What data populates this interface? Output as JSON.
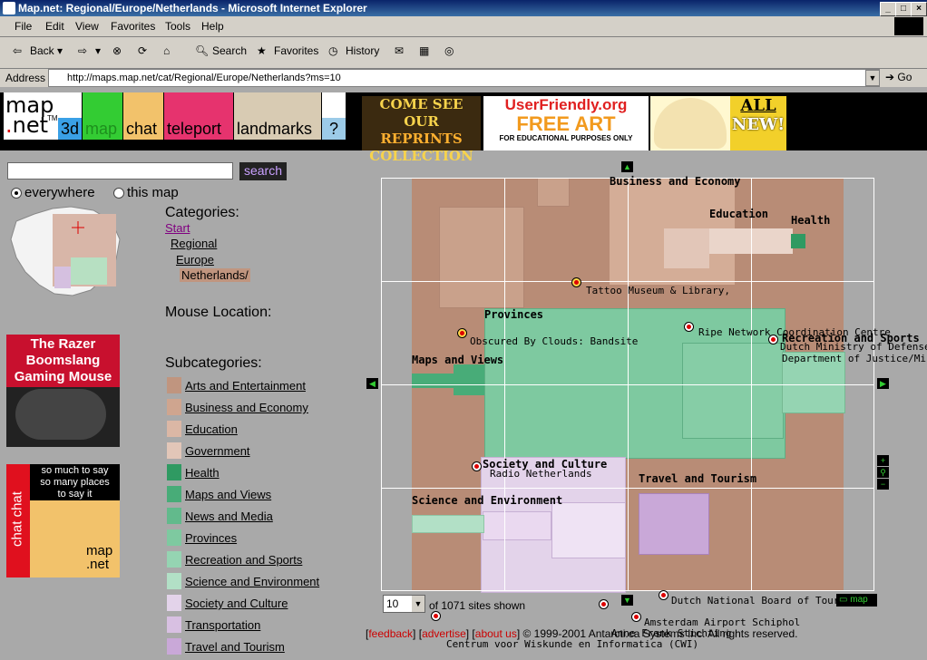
{
  "window": {
    "title": "Map.net: Regional/Europe/Netherlands - Microsoft Internet Explorer"
  },
  "menu": [
    "File",
    "Edit",
    "View",
    "Favorites",
    "Tools",
    "Help"
  ],
  "toolbar": {
    "back": "Back",
    "search": "Search",
    "favorites": "Favorites",
    "history": "History"
  },
  "address": {
    "label": "Address",
    "url": "http://maps.map.net/cat/Regional/Europe/Netherlands?ms=10",
    "go": "Go"
  },
  "nav": {
    "logo_top": "map",
    "logo_bottom": "net",
    "tm": "TM",
    "threed": "3d",
    "map": "map",
    "chat": "chat",
    "teleport": "teleport",
    "landmarks": "landmarks",
    "help": "?"
  },
  "banner": {
    "reprints_1": "COME SEE OUR",
    "reprints_2": "REPRINTS",
    "reprints_3": "COLLECTION",
    "uf_title": "UserFriendly.org",
    "uf_art": "FREE ART",
    "uf_note": "FOR EDUCATIONAL PURPOSES ONLY",
    "all_new_1": "ALL",
    "all_new_2": "NEW!"
  },
  "search": {
    "value": "",
    "button": "search",
    "everywhere": "everywhere",
    "this_map": "this map"
  },
  "categories": {
    "heading": "Categories:",
    "crumbs": [
      "Start",
      "Regional",
      "Europe",
      "Netherlands/"
    ]
  },
  "mouse_location": "Mouse Location:",
  "subcategories": {
    "heading": "Subcategories:",
    "items": [
      {
        "label": "Arts and Entertainment",
        "color": "#c0957f"
      },
      {
        "label": "Business and Economy",
        "color": "#cfa58f"
      },
      {
        "label": "Education",
        "color": "#dbb7a5"
      },
      {
        "label": "Government",
        "color": "#e2c6b8"
      },
      {
        "label": "Health",
        "color": "#2f9a62"
      },
      {
        "label": "Maps and Views",
        "color": "#48ac78"
      },
      {
        "label": "News and Media",
        "color": "#62ba8c"
      },
      {
        "label": "Provinces",
        "color": "#7ec9a0"
      },
      {
        "label": "Recreation and Sports",
        "color": "#95d4b2"
      },
      {
        "label": "Science and Environment",
        "color": "#b2e0c6"
      },
      {
        "label": "Society and Culture",
        "color": "#e3d3ea"
      },
      {
        "label": "Transportation",
        "color": "#d8c0e2"
      },
      {
        "label": "Travel and Tourism",
        "color": "#c9a8d8"
      }
    ]
  },
  "ads": {
    "razer": "The Razer Boomslang Gaming Mouse",
    "chat_side": "chat chat",
    "chat_1": "so much to say",
    "chat_2": "so many places",
    "chat_3": "to say it",
    "chat_map": "map",
    "chat_net": ".net"
  },
  "map": {
    "categories": {
      "business": "Business and Economy",
      "education": "Education",
      "health": "Health",
      "provinces": "Provinces",
      "maps": "Maps and Views",
      "recreation": "Recreation and Sports",
      "society": "Society and Culture",
      "travel": "Travel and Tourism",
      "science": "Science and Environment"
    },
    "sites": {
      "tattoo": "Tattoo Museum & Library,",
      "obscured": "Obscured By Clouds: Bandsite",
      "ripe": "Ripe Network Coordination Centre",
      "defense": "Dutch Ministry of Defense",
      "justice": "Department of Justice/Mi",
      "radio": "Radio Netherlands",
      "tourism": "Dutch National Board of Tourism",
      "schiphol": "Amsterdam Airport Schiphol",
      "anne": "Anne Frank Stichting",
      "cwi": "Centrum voor Wiskunde en Informatica (CWI)"
    }
  },
  "map_controls": {
    "count": "10",
    "shown": "of 1071 sites shown",
    "map_btn": "map"
  },
  "footer": {
    "feedback": "feedback",
    "advertise": "advertise",
    "about": "about us",
    "copyright": "© 1999-2001 Antarcti.ca Systems Inc. All rights reserved."
  }
}
